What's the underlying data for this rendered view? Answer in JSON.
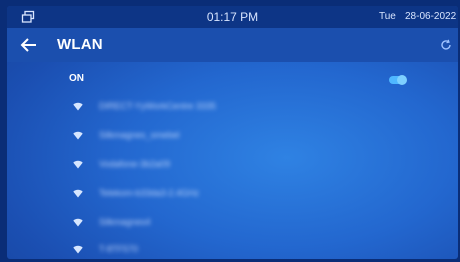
{
  "statusbar": {
    "window_icon": "window-icon",
    "time": "01:17 PM",
    "day": "Tue",
    "date": "28-06-2022"
  },
  "header": {
    "back_icon": "back-arrow-icon",
    "title": "WLAN",
    "refresh_icon": "refresh-icon"
  },
  "wifi": {
    "toggle_label": "ON",
    "enabled": true
  },
  "networks": [
    {
      "name": "DIRECT-YyWorkCentre 3335",
      "icon": "wifi-icon"
    },
    {
      "name": "Silkmagnes_smebel",
      "icon": "wifi-icon"
    },
    {
      "name": "Vodafone-3b2a09",
      "icon": "wifi-icon"
    },
    {
      "name": "Telekom-b33da3-2.4GHz",
      "icon": "wifi-icon"
    },
    {
      "name": "Silkmagnes4",
      "icon": "wifi-icon"
    },
    {
      "name": "T-8TF570",
      "icon": "wifi-icon"
    }
  ],
  "colors": {
    "status_bar": "#0d3586",
    "header": "#1b4fae",
    "screen": "#2367cf",
    "toggle_accent": "#4fb7ff"
  }
}
